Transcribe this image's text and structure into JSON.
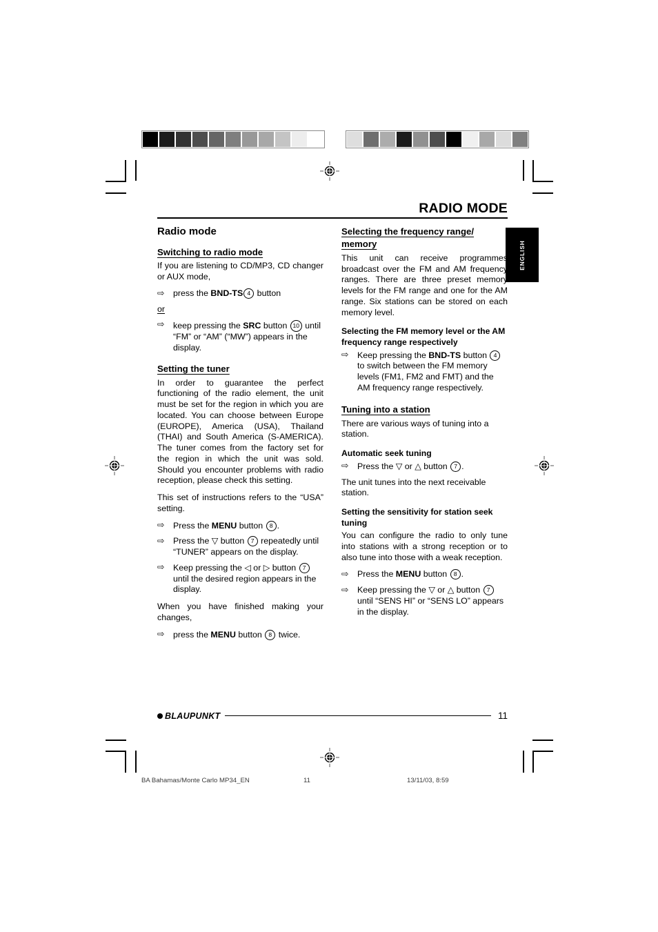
{
  "running_head": "RADIO MODE",
  "language_tab": "ENGLISH",
  "calibration": {
    "left_bar": [
      "#000000",
      "#1b1b1b",
      "#333333",
      "#4d4d4d",
      "#666666",
      "#7f7f7f",
      "#999999",
      "#a8a8a8",
      "#c4c4c4",
      "#ededed",
      "#ffffff"
    ],
    "right_bar": [
      "#dedede",
      "#6e6e6e",
      "#acacac",
      "#1b1b1b",
      "#909090",
      "#4d4d4d",
      "#000000",
      "#f0f0f0",
      "#a8a8a8",
      "#dcdcdc",
      "#808080"
    ]
  },
  "left_column": {
    "section_title": "Radio mode",
    "sub1": {
      "heading": "Switching to radio mode",
      "intro": "If you are listening to CD/MP3, CD changer or AUX mode,",
      "step1_pre": "press the ",
      "step1_bold": "BND-TS",
      "step1_num": "4",
      "step1_post": " button",
      "or": "or",
      "step2_pre": "keep pressing the ",
      "step2_bold": "SRC",
      "step2_mid": " button ",
      "step2_num": "10",
      "step2_post": " until “FM” or “AM” (“MW”) appears in the display."
    },
    "sub2": {
      "heading": "Setting the tuner",
      "para1": "In order to guarantee the perfect functioning of the radio element, the unit must be set for the region in which you are located. You can choose between Europe (EUROPE), America (USA), Thailand (THAI) and South America (S-AMERICA). The tuner comes from the factory set for the region in which the unit was sold. Should you encounter problems with radio reception, please check this setting.",
      "para2": "This set of instructions refers to the “USA” setting.",
      "step1_pre": "Press the ",
      "step1_bold": "MENU",
      "step1_mid": " button ",
      "step1_num": "8",
      "step1_post": ".",
      "step2_pre": "Press the ",
      "step2_glyph": "▽",
      "step2_mid": " button ",
      "step2_num": "7",
      "step2_post": " repeatedly until “TUNER” appears on the display.",
      "step3_pre": "Keep pressing the ",
      "step3_glyph_a": "◁",
      "step3_glyph_or": " or ",
      "step3_glyph_b": "▷",
      "step3_mid": " button ",
      "step3_num": "7",
      "step3_post": " until the desired region appears in the display.",
      "para3": "When you have finished making your changes,",
      "step4_pre": "press the ",
      "step4_bold": "MENU",
      "step4_mid": " button ",
      "step4_num": "8",
      "step4_post": " twice."
    }
  },
  "right_column": {
    "sub1": {
      "heading": "Selecting the frequency range/ memory",
      "para1": "This unit can receive programmes broadcast over the FM and AM frequency ranges. There are three preset memory levels for the FM range and one for the AM range. Six stations can be stored on each memory level."
    },
    "sub2": {
      "heading": "Selecting the FM memory level or the AM frequency range respectively",
      "step1_pre": "Keep pressing the ",
      "step1_bold": "BND-TS",
      "step1_mid": " button ",
      "step1_num": "4",
      "step1_post": " to switch between the FM memory levels (FM1, FM2 and FMT) and the AM frequency range respectively."
    },
    "sub3": {
      "heading": "Tuning into a station",
      "para1": "There are various ways of tuning into a station.",
      "bold_head1": "Automatic seek tuning",
      "step1_pre": "Press the ",
      "step1_glyph_a": "▽",
      "step1_glyph_or": " or ",
      "step1_glyph_b": "△",
      "step1_mid": " button ",
      "step1_num": "7",
      "step1_post": ".",
      "para2": "The unit tunes into the next receivable station.",
      "bold_head2": "Setting the sensitivity for station seek tuning",
      "para3": "You can configure the radio to only tune into stations with a strong reception or to also tune into those with a weak reception.",
      "step2_pre": "Press the ",
      "step2_bold": "MENU",
      "step2_mid": " button ",
      "step2_num": "8",
      "step2_post": ".",
      "step3_pre": "Keep pressing the ",
      "step3_glyph_a": "▽",
      "step3_glyph_or": " or ",
      "step3_glyph_b": "△",
      "step3_mid": " button ",
      "step3_num": "7",
      "step3_post": " until “SENS HI” or “SENS LO” appears in the display."
    }
  },
  "footer": {
    "logo": "BLAUPUNKT",
    "page_number": "11"
  },
  "meta": {
    "file": "BA Bahamas/Monte Carlo MP34_EN",
    "page": "11",
    "date": "13/11/03, 8:59"
  },
  "icons": {
    "arrow_bullet": "⇨"
  }
}
